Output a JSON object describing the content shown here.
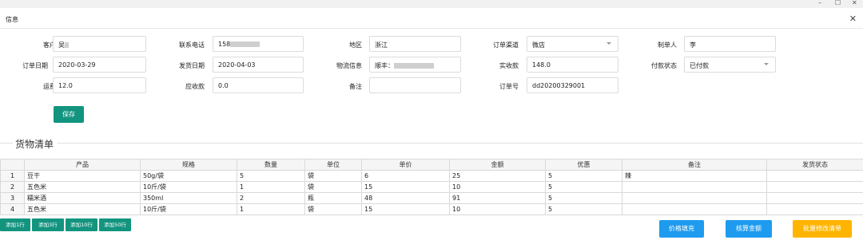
{
  "window": {
    "minimize": "–",
    "maximize": "☐",
    "close": "✕"
  },
  "dialog": {
    "title": "信息",
    "close": "✕"
  },
  "form": {
    "customer": {
      "label": "客户",
      "value": "吴"
    },
    "phone": {
      "label": "联系电话",
      "value": "158"
    },
    "region": {
      "label": "地区",
      "value": "浙江"
    },
    "channel": {
      "label": "订单渠道",
      "value": "微店"
    },
    "maker": {
      "label": "制单人",
      "value": "李"
    },
    "order_date": {
      "label": "订单日期",
      "value": "2020-03-29"
    },
    "ship_date": {
      "label": "发货日期",
      "value": "2020-04-03"
    },
    "logistics": {
      "label": "物流信息",
      "value": "顺丰："
    },
    "received": {
      "label": "实收款",
      "value": "148.0"
    },
    "pay_status": {
      "label": "付款状态",
      "value": "已付款"
    },
    "freight": {
      "label": "运费",
      "value": "12.0"
    },
    "receivable": {
      "label": "应收款",
      "value": "0.0"
    },
    "remark": {
      "label": "备注",
      "value": ""
    },
    "order_no": {
      "label": "订单号",
      "value": "dd20200329001"
    },
    "save": "保存"
  },
  "goods": {
    "title": "货物清单",
    "columns": [
      "",
      "产品",
      "规格",
      "数量",
      "单位",
      "单价",
      "金额",
      "优惠",
      "备注",
      "发货状态"
    ],
    "rows": [
      [
        "1",
        "豆干",
        "50g/袋",
        "5",
        "袋",
        "6",
        "25",
        "5",
        "辣",
        ""
      ],
      [
        "2",
        "五色米",
        "10斤/袋",
        "1",
        "袋",
        "15",
        "10",
        "5",
        "",
        ""
      ],
      [
        "3",
        "糯米酒",
        "350ml",
        "2",
        "瓶",
        "48",
        "91",
        "5",
        "",
        ""
      ],
      [
        "4",
        "五色米",
        "10斤/袋",
        "1",
        "袋",
        "15",
        "10",
        "5",
        "",
        ""
      ]
    ]
  },
  "add_buttons": [
    "添加1行",
    "添加3行",
    "添加10行",
    "添加50行"
  ],
  "actions": {
    "fill_price": "价格填充",
    "calc_amount": "核算金额",
    "batch_edit": "批量修改清单"
  },
  "colors": {
    "primary": "#12947f",
    "blue": "#1e9bef",
    "orange": "#ffb400"
  }
}
